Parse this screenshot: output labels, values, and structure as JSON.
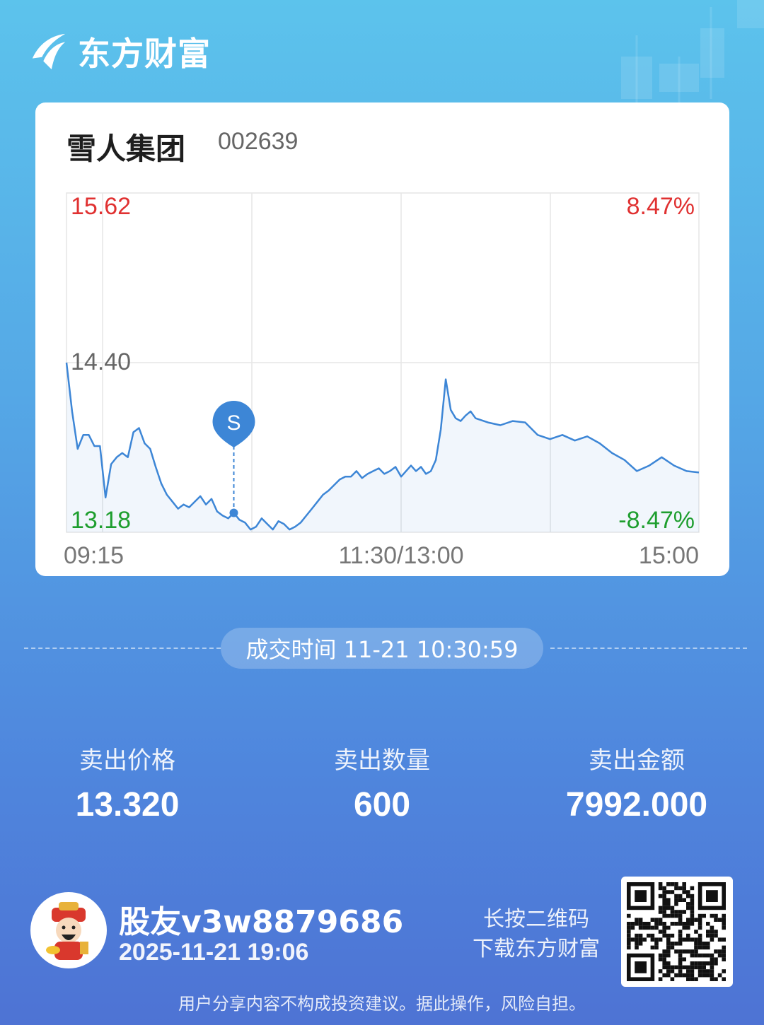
{
  "brand": {
    "name": "东方财富"
  },
  "stock": {
    "name": "雪人集团",
    "code": "002639"
  },
  "chart_data": {
    "type": "line",
    "title": "",
    "y_ticks": [
      "15.62",
      "14.40",
      "13.18"
    ],
    "pct_ticks": [
      "8.47%",
      "-8.47%"
    ],
    "x_ticks": [
      "09:15",
      "11:30/13:00",
      "15:00"
    ],
    "ylim": [
      13.18,
      15.62
    ],
    "marker": {
      "label": "S",
      "time": "10:30",
      "price": 13.32
    },
    "series": [
      {
        "x": [
          "09:30",
          "09:32",
          "09:34",
          "09:36",
          "09:38",
          "09:40",
          "09:42",
          "09:44",
          "09:46",
          "09:48",
          "09:50",
          "09:52",
          "09:54",
          "09:56",
          "09:58",
          "10:00",
          "10:02",
          "10:04",
          "10:06",
          "10:08",
          "10:10",
          "10:12",
          "10:14",
          "10:16",
          "10:18",
          "10:20",
          "10:22",
          "10:24",
          "10:26",
          "10:28",
          "10:30",
          "10:32",
          "10:34",
          "10:36",
          "10:38",
          "10:40",
          "10:42",
          "10:44",
          "10:46",
          "10:48",
          "10:50",
          "10:52",
          "10:54",
          "10:56",
          "10:58",
          "11:00",
          "11:02",
          "11:04",
          "11:06",
          "11:08",
          "11:10",
          "11:12",
          "11:14",
          "11:16",
          "11:18",
          "11:20",
          "11:22",
          "11:24",
          "11:26",
          "11:28",
          "11:30",
          "13:02",
          "13:04",
          "13:06",
          "13:08",
          "13:10",
          "13:12",
          "13:14",
          "13:16",
          "13:18",
          "13:20",
          "13:22",
          "13:24",
          "13:26",
          "13:28",
          "13:30",
          "13:35",
          "13:40",
          "13:45",
          "13:50",
          "13:55",
          "14:00",
          "14:05",
          "14:10",
          "14:15",
          "14:20",
          "14:25",
          "14:30",
          "14:35",
          "14:40",
          "14:45",
          "14:50",
          "14:55",
          "15:00"
        ],
        "values": [
          14.4,
          14.05,
          13.78,
          13.88,
          13.88,
          13.8,
          13.8,
          13.43,
          13.67,
          13.72,
          13.75,
          13.72,
          13.9,
          13.93,
          13.82,
          13.78,
          13.65,
          13.53,
          13.45,
          13.4,
          13.35,
          13.38,
          13.36,
          13.4,
          13.44,
          13.38,
          13.42,
          13.33,
          13.3,
          13.28,
          13.32,
          13.27,
          13.25,
          13.2,
          13.22,
          13.28,
          13.24,
          13.2,
          13.26,
          13.24,
          13.2,
          13.22,
          13.25,
          13.3,
          13.35,
          13.4,
          13.45,
          13.48,
          13.52,
          13.56,
          13.58,
          13.58,
          13.62,
          13.57,
          13.6,
          13.62,
          13.64,
          13.6,
          13.62,
          13.65,
          13.58,
          13.62,
          13.66,
          13.62,
          13.65,
          13.6,
          13.62,
          13.7,
          13.92,
          14.28,
          14.06,
          14.0,
          13.98,
          14.02,
          14.05,
          14.0,
          13.97,
          13.95,
          13.98,
          13.97,
          13.88,
          13.85,
          13.88,
          13.84,
          13.87,
          13.82,
          13.75,
          13.7,
          13.62,
          13.66,
          13.72,
          13.66,
          13.62,
          13.61
        ]
      }
    ]
  },
  "trade": {
    "time_label": "成交时间 11-21 10:30:59",
    "price_label": "卖出价格",
    "price_value": "13.320",
    "qty_label": "卖出数量",
    "qty_value": "600",
    "amount_label": "卖出金额",
    "amount_value": "7992.000"
  },
  "user": {
    "name": "股友v3w8879686",
    "datetime": "2025-11-21 19:06"
  },
  "qr": {
    "hint_line1": "长按二维码",
    "hint_line2": "下载东方财富"
  },
  "footer": {
    "disclaimer": "用户分享内容不构成投资建议。据此操作，风险自担。"
  },
  "colors": {
    "up": "#e03131",
    "down": "#1e9e2e",
    "line": "#3d86d6",
    "neutral": "#666666"
  }
}
